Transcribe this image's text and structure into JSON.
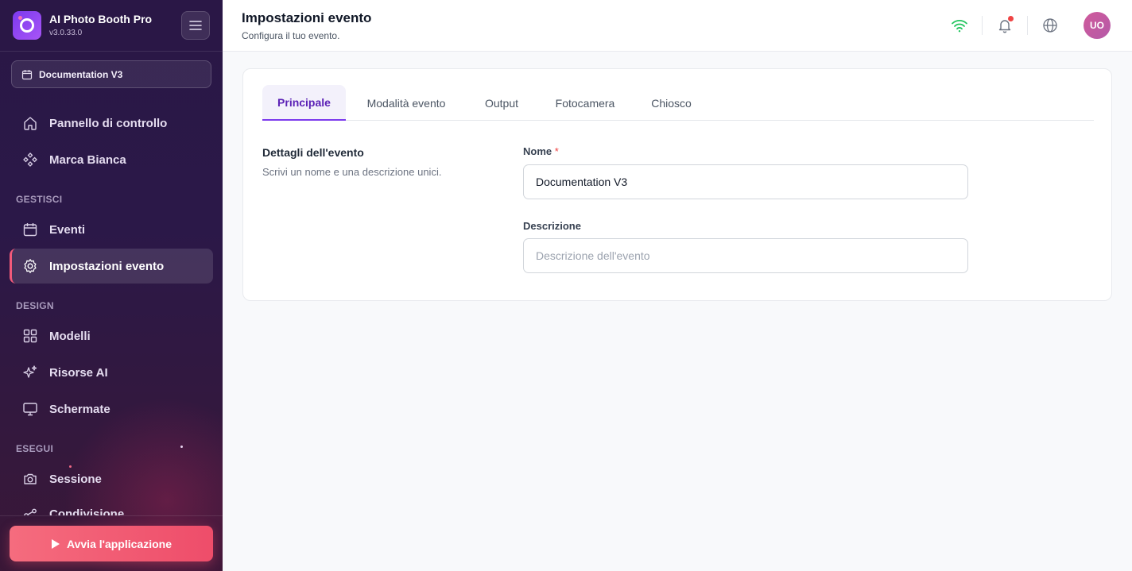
{
  "app": {
    "name": "AI Photo Booth Pro",
    "version": "v3.0.33.0"
  },
  "sidebar": {
    "event_selector": "Documentation V3",
    "nav": {
      "dashboard": "Pannello di controllo",
      "white_label": "Marca Bianca",
      "section_manage": "GESTISCI",
      "events": "Eventi",
      "event_settings": "Impostazioni evento",
      "section_design": "DESIGN",
      "templates": "Modelli",
      "ai_resources": "Risorse AI",
      "screens": "Schermate",
      "section_run": "ESEGUI",
      "session": "Sessione",
      "sharing": "Condivisione"
    },
    "launch_button": "Avvia l'applicazione"
  },
  "header": {
    "title": "Impostazioni evento",
    "subtitle": "Configura il tuo evento.",
    "avatar_initials": "UO"
  },
  "tabs": [
    "Principale",
    "Modalità evento",
    "Output",
    "Fotocamera",
    "Chiosco"
  ],
  "details": {
    "title": "Dettagli dell'evento",
    "description": "Scrivi un nome e una descrizione unici.",
    "name_label": "Nome",
    "required_mark": "*",
    "name_value": "Documentation V3",
    "description_label": "Descrizione",
    "description_placeholder": "Descrizione dell'evento"
  },
  "colors": {
    "accent": "#7c3aed",
    "launch": "#f05a72",
    "wifi": "#22c55e",
    "notification": "#ef4444"
  }
}
